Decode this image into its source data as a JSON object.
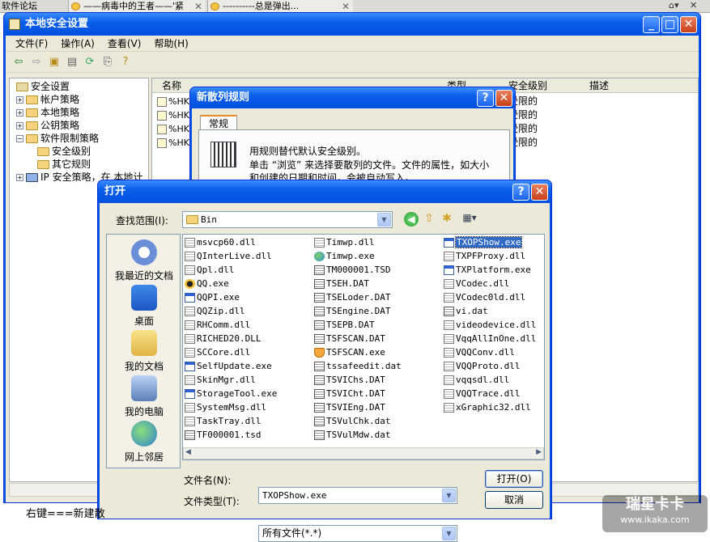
{
  "browser_tabs": [
    {
      "label": "软件论坛"
    },
    {
      "label": "——病毒中的王者——'紧"
    },
    {
      "label": "----------总是弹出..."
    }
  ],
  "main_window": {
    "title": "本地安全设置",
    "menu": [
      "文件(F)",
      "操作(A)",
      "查看(V)",
      "帮助(H)"
    ],
    "tree": [
      {
        "label": "安全设置",
        "level": 0
      },
      {
        "label": "帐户策略",
        "level": 1
      },
      {
        "label": "本地策略",
        "level": 1
      },
      {
        "label": "公钥策略",
        "level": 1
      },
      {
        "label": "软件限制策略",
        "level": 1
      },
      {
        "label": "安全级别",
        "level": 2
      },
      {
        "label": "其它规则",
        "level": 2
      },
      {
        "label": "IP 安全策略，在 本地计",
        "level": 1
      }
    ],
    "columns": [
      "名称",
      "类型",
      "安全级别",
      "描述"
    ],
    "rows": [
      {
        "name": "%HKEY",
        "level": "受限的"
      },
      {
        "name": "%HKEY",
        "level": "受限的"
      },
      {
        "name": "%HKEY",
        "level": "受限的"
      },
      {
        "name": "%HKEY",
        "level": "受限的"
      }
    ]
  },
  "hash_dialog": {
    "title": "新散列规则",
    "tab": "常规",
    "line1": "用规则替代默认安全级别。",
    "line2": "单击 “浏览” 来选择要散列的文件。文件的属性，如大小",
    "line3": "和创建的日期和时间，会被自动写入。"
  },
  "open_dialog": {
    "title": "打开",
    "lookin_label": "查找范围(I):",
    "lookin_value": "Bin",
    "places": [
      "我最近的文档",
      "桌面",
      "我的文档",
      "我的电脑",
      "网上邻居"
    ],
    "files_col1": [
      {
        "name": "msvcp60.dll",
        "icon": "dll"
      },
      {
        "name": "QInterLive.dll",
        "icon": "dll"
      },
      {
        "name": "Qpl.dll",
        "icon": "dll"
      },
      {
        "name": "QQ.exe",
        "icon": "qq"
      },
      {
        "name": "QQPI.exe",
        "icon": "exe"
      },
      {
        "name": "QQZip.dll",
        "icon": "dll"
      },
      {
        "name": "RHComm.dll",
        "icon": "dll"
      },
      {
        "name": "RICHED20.DLL",
        "icon": "dll"
      },
      {
        "name": "SCCore.dll",
        "icon": "dll"
      },
      {
        "name": "SelfUpdate.exe",
        "icon": "exe"
      },
      {
        "name": "SkinMgr.dll",
        "icon": "dll"
      },
      {
        "name": "StorageTool.exe",
        "icon": "exe"
      },
      {
        "name": "SystemMsg.dll",
        "icon": "dll"
      },
      {
        "name": "TaskTray.dll",
        "icon": "dll"
      },
      {
        "name": "TF000001.tsd",
        "icon": "tsd"
      }
    ],
    "files_col2": [
      {
        "name": "Timwp.dll",
        "icon": "dll"
      },
      {
        "name": "Timwp.exe",
        "icon": "globe"
      },
      {
        "name": "TM000001.TSD",
        "icon": "tsd"
      },
      {
        "name": "TSEH.DAT",
        "icon": "dat"
      },
      {
        "name": "TSELoder.DAT",
        "icon": "dat"
      },
      {
        "name": "TSEngine.DAT",
        "icon": "dat"
      },
      {
        "name": "TSEPB.DAT",
        "icon": "dat"
      },
      {
        "name": "TSFSCAN.DAT",
        "icon": "dat"
      },
      {
        "name": "TSFSCAN.exe",
        "icon": "sh"
      },
      {
        "name": "tssafeedit.dat",
        "icon": "dat"
      },
      {
        "name": "TSVIChs.DAT",
        "icon": "dat"
      },
      {
        "name": "TSVICht.DAT",
        "icon": "dat"
      },
      {
        "name": "TSVIEng.DAT",
        "icon": "dat"
      },
      {
        "name": "TSVulChk.dat",
        "icon": "dat"
      },
      {
        "name": "TSVulMdw.dat",
        "icon": "dat"
      }
    ],
    "files_col3": [
      {
        "name": "TXOPShow.exe",
        "icon": "exe",
        "selected": true
      },
      {
        "name": "TXPFProxy.dll",
        "icon": "dll"
      },
      {
        "name": "TXPlatform.exe",
        "icon": "exe"
      },
      {
        "name": "VCodec.dll",
        "icon": "dll"
      },
      {
        "name": "VCodec0ld.dll",
        "icon": "dll"
      },
      {
        "name": "vi.dat",
        "icon": "dat"
      },
      {
        "name": "videodevice.dll",
        "icon": "dll"
      },
      {
        "name": "VqqAllInOne.dll",
        "icon": "dll"
      },
      {
        "name": "VQQConv.dll",
        "icon": "dll"
      },
      {
        "name": "VQQProto.dll",
        "icon": "dll"
      },
      {
        "name": "vqqsdl.dll",
        "icon": "dll"
      },
      {
        "name": "VQQTrace.dll",
        "icon": "dll"
      },
      {
        "name": "xGraphic32.dll",
        "icon": "dll"
      }
    ],
    "filename_label": "文件名(N):",
    "filename_value": "TXOPShow.exe",
    "filetype_label": "文件类型(T):",
    "filetype_value": "所有文件(*.*)",
    "open_button": "打开(O)",
    "cancel_button": "取消"
  },
  "bottom_text": "右键===新建散",
  "watermark": {
    "line1": "瑞星卡卡",
    "line2": "www.ikaka.com"
  }
}
